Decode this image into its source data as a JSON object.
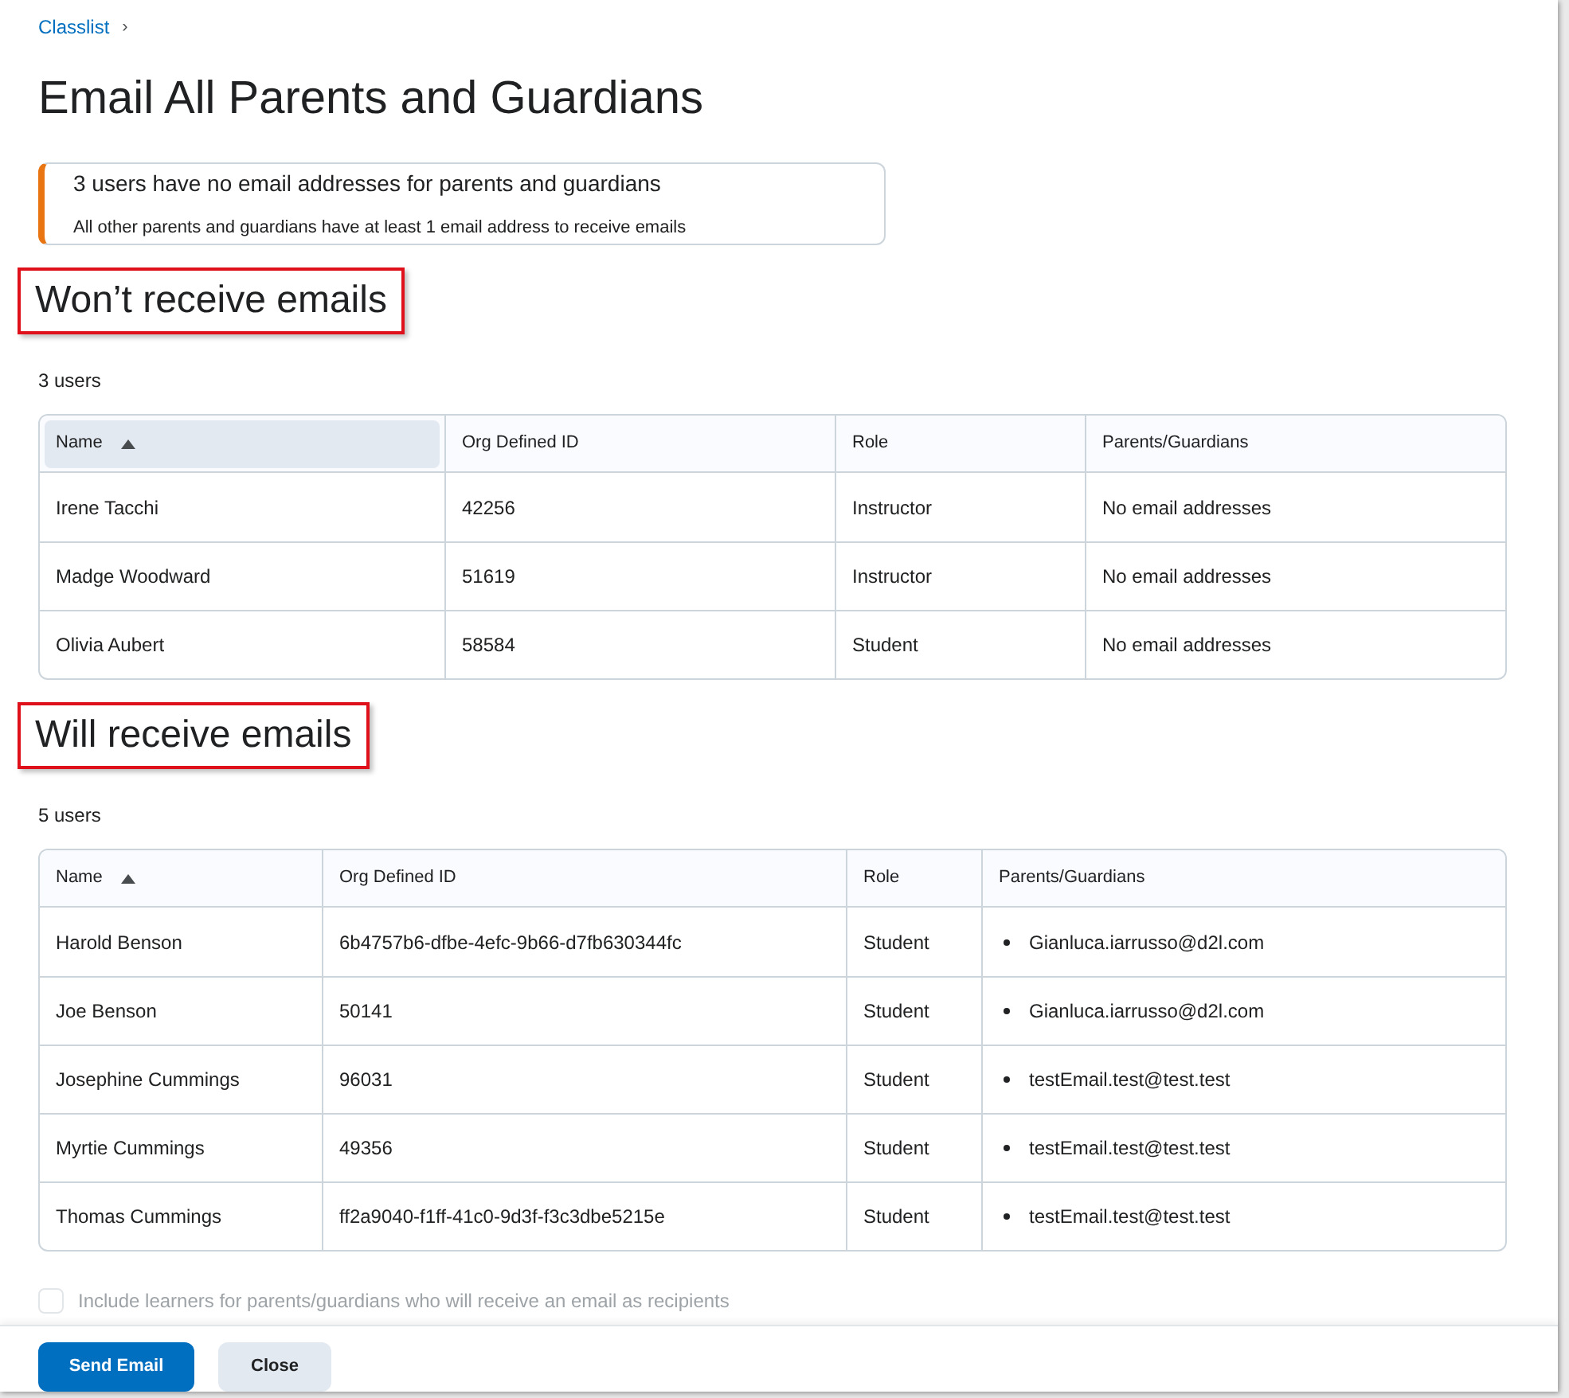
{
  "breadcrumb": {
    "link": "Classlist",
    "separator": "›"
  },
  "title": "Email All Parents and Guardians",
  "alert": {
    "heading": "3 users have no email addresses for parents and guardians",
    "body": "All other parents and guardians have at least 1 email address to receive emails"
  },
  "sections": [
    {
      "heading": "Won’t receive emails",
      "count": "3 users",
      "columns": [
        {
          "label": "Name",
          "sorted": true,
          "highlighted": true
        },
        {
          "label": "Org Defined ID",
          "sorted": false,
          "highlighted": false
        },
        {
          "label": "Role",
          "sorted": false,
          "highlighted": false
        },
        {
          "label": "Parents/Guardians",
          "sorted": false,
          "highlighted": false
        }
      ],
      "rows": [
        {
          "name": "Irene Tacchi",
          "id": "42256",
          "role": "Instructor",
          "guardians": {
            "kind": "text",
            "text": "No email addresses"
          }
        },
        {
          "name": "Madge Woodward",
          "id": "51619",
          "role": "Instructor",
          "guardians": {
            "kind": "text",
            "text": "No email addresses"
          }
        },
        {
          "name": "Olivia Aubert",
          "id": "58584",
          "role": "Student",
          "guardians": {
            "kind": "text",
            "text": "No email addresses"
          }
        }
      ]
    },
    {
      "heading": "Will receive emails",
      "count": "5 users",
      "columns": [
        {
          "label": "Name",
          "sorted": true,
          "highlighted": false
        },
        {
          "label": "Org Defined ID",
          "sorted": false,
          "highlighted": false
        },
        {
          "label": "Role",
          "sorted": false,
          "highlighted": false
        },
        {
          "label": "Parents/Guardians",
          "sorted": false,
          "highlighted": false
        }
      ],
      "rows": [
        {
          "name": "Harold Benson",
          "id": "6b4757b6-dfbe-4efc-9b66-d7fb630344fc",
          "role": "Student",
          "guardians": {
            "kind": "list",
            "items": [
              "Gianluca.iarrusso@d2l.com"
            ]
          }
        },
        {
          "name": "Joe Benson",
          "id": "50141",
          "role": "Student",
          "guardians": {
            "kind": "list",
            "items": [
              "Gianluca.iarrusso@d2l.com"
            ]
          }
        },
        {
          "name": "Josephine Cummings",
          "id": "96031",
          "role": "Student",
          "guardians": {
            "kind": "list",
            "items": [
              "testEmail.test@test.test"
            ]
          }
        },
        {
          "name": "Myrtie Cummings",
          "id": "49356",
          "role": "Student",
          "guardians": {
            "kind": "list",
            "items": [
              "testEmail.test@test.test"
            ]
          }
        },
        {
          "name": "Thomas Cummings",
          "id": "ff2a9040-f1ff-41c0-9d3f-f3c3dbe5215e",
          "role": "Student",
          "guardians": {
            "kind": "list",
            "items": [
              "testEmail.test@test.test"
            ]
          }
        }
      ]
    }
  ],
  "include_learners": {
    "label": "Include learners for parents/guardians who will receive an email as recipients",
    "checked": false,
    "disabled": true
  },
  "buttons": [
    {
      "label": "Send Email",
      "kind": "primary"
    },
    {
      "label": "Close",
      "kind": "secondary"
    }
  ]
}
